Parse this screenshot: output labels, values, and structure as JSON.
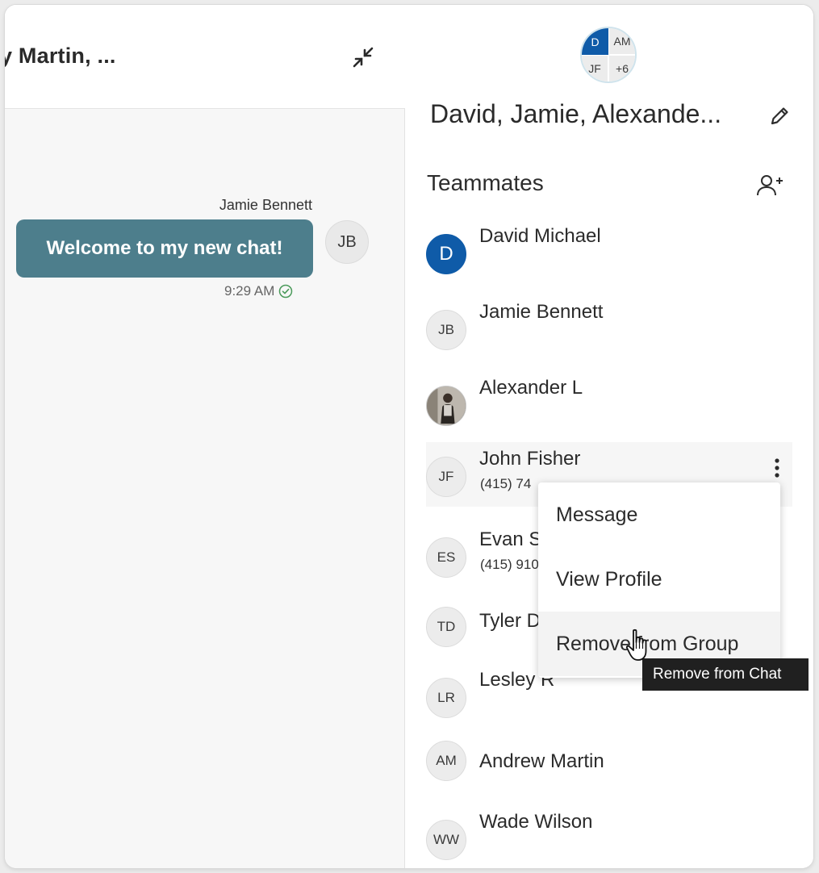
{
  "chat": {
    "title": "y Martin, ...",
    "message": {
      "sender": "Jamie Bennett",
      "text": "Welcome to my new chat!",
      "avatar_initials": "JB",
      "time": "9:29 AM",
      "status_icon": "check-circle-icon"
    }
  },
  "details": {
    "group_avatar": {
      "q1": "D",
      "q2": "AM",
      "q3": "JF",
      "q4": "+6"
    },
    "group_name": "David, Jamie, Alexande...",
    "section_title": "Teammates",
    "members": [
      {
        "initials": "D",
        "name": "David Michael",
        "phone": ""
      },
      {
        "initials": "JB",
        "name": "Jamie Bennett",
        "phone": ""
      },
      {
        "initials": "",
        "name": "Alexander L",
        "phone": ""
      },
      {
        "initials": "JF",
        "name": "John Fisher",
        "phone": "(415) 74"
      },
      {
        "initials": "ES",
        "name": "Evan S",
        "phone": "(415) 910"
      },
      {
        "initials": "TD",
        "name": "Tyler D",
        "phone": ""
      },
      {
        "initials": "LR",
        "name": "Lesley R",
        "phone": ""
      },
      {
        "initials": "AM",
        "name": "Andrew Martin",
        "phone": ""
      },
      {
        "initials": "WW",
        "name": "Wade Wilson",
        "phone": ""
      }
    ]
  },
  "menu": {
    "items": [
      "Message",
      "View Profile",
      "Remove from Group"
    ]
  },
  "tooltip": {
    "text": "Remove from Chat"
  },
  "colors": {
    "bubble": "#4d7e8c",
    "brand_blue": "#0f5ba8",
    "tooltip_bg": "#202020",
    "check_green": "#4a9a5a"
  },
  "icons": {
    "collapse": "collapse-arrows-icon",
    "edit": "pencil-icon",
    "add_member": "add-person-icon",
    "more": "kebab-menu-icon",
    "cursor": "hand-pointer-icon"
  }
}
